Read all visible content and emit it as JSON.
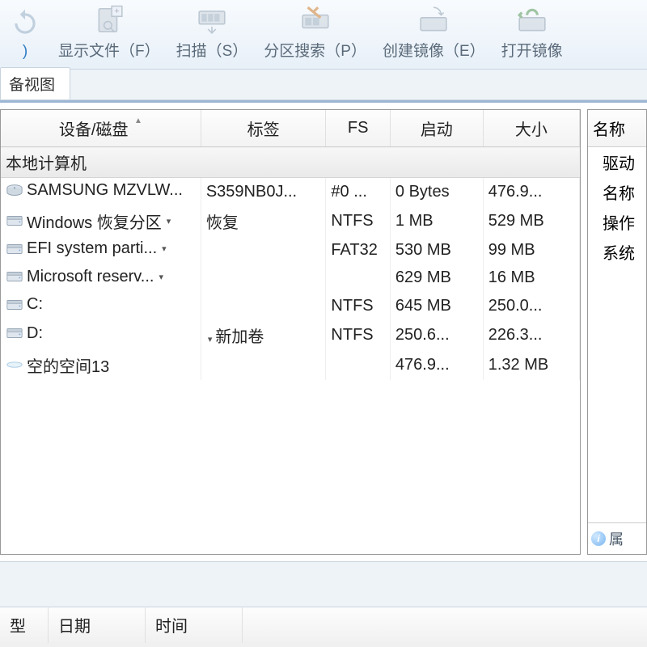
{
  "ribbon": {
    "buttons": [
      {
        "label": ")",
        "icon": "refresh"
      },
      {
        "label": "显示文件（F）",
        "icon": "show-files"
      },
      {
        "label": "扫描（S）",
        "icon": "scan"
      },
      {
        "label": "分区搜索（P）",
        "icon": "partition-search"
      },
      {
        "label": "创建镜像（E）",
        "icon": "create-image"
      },
      {
        "label": "打开镜像",
        "icon": "open-image"
      }
    ]
  },
  "tabstrip": {
    "tabs": [
      {
        "label": "备视图"
      }
    ]
  },
  "table": {
    "headers": {
      "device": "设备/磁盘",
      "label": "标签",
      "fs": "FS",
      "start": "启动",
      "size": "大小"
    },
    "group_row": "本地计算机",
    "rows": [
      {
        "icon": "disk",
        "device": "SAMSUNG MZVLW...",
        "label": "S359NB0J...",
        "fs": "#0 ...",
        "start": "0 Bytes",
        "size": "476.9..."
      },
      {
        "icon": "vol",
        "device": "Windows 恢复分区",
        "label": "恢复",
        "fs": "NTFS",
        "start": "1 MB",
        "size": "529 MB",
        "dropdown": true
      },
      {
        "icon": "vol",
        "device": "EFI system parti...",
        "label": "",
        "fs": "FAT32",
        "start": "530 MB",
        "size": "99 MB",
        "dropdown": true
      },
      {
        "icon": "vol",
        "device": "Microsoft reserv...",
        "label": "",
        "fs": "",
        "start": "629 MB",
        "size": "16 MB",
        "dropdown": true
      },
      {
        "icon": "vol",
        "device": "C:",
        "label": "",
        "fs": "NTFS",
        "start": "645 MB",
        "size": "250.0..."
      },
      {
        "icon": "vol",
        "device": "D:",
        "label": "新加卷",
        "fs": "NTFS",
        "start": "250.6...",
        "size": "226.3...",
        "label_dropdown": true
      },
      {
        "icon": "empty",
        "device": "空的空间13",
        "label": "",
        "fs": "",
        "start": "476.9...",
        "size": "1.32 MB"
      }
    ]
  },
  "right": {
    "header": "名称",
    "items": [
      "驱动",
      "名称",
      "操作",
      "系统"
    ],
    "footer_label": "属"
  },
  "bottom": {
    "cols": [
      "型",
      "日期",
      "时间"
    ]
  }
}
